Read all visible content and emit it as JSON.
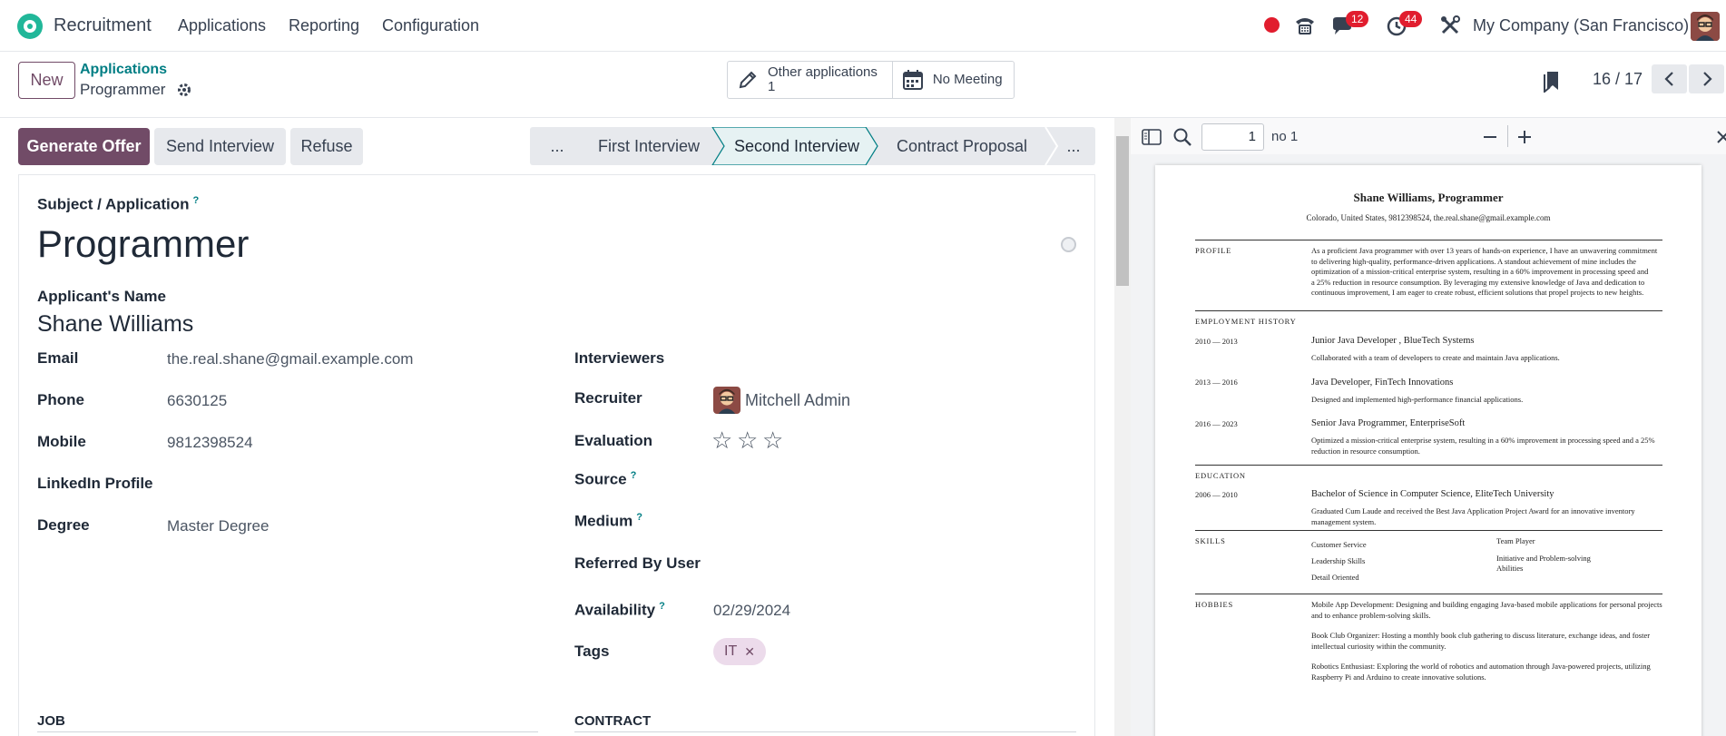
{
  "nav": {
    "app_name": "Recruitment",
    "menu": [
      "Applications",
      "Reporting",
      "Configuration"
    ],
    "messages_count": "12",
    "activities_count": "44",
    "company": "My Company (San Francisco)"
  },
  "control": {
    "new_label": "New",
    "breadcrumb_parent": "Applications",
    "breadcrumb_current": "Programmer",
    "other_applications_label": "Other applications",
    "other_applications_count": "1",
    "meeting_label": "No Meeting",
    "pager": "16 / 17"
  },
  "actions": {
    "generate_offer": "Generate Offer",
    "send_interview": "Send Interview",
    "refuse": "Refuse"
  },
  "stages": {
    "more_left": "...",
    "first": "First Interview",
    "current": "Second Interview",
    "next": "Contract Proposal",
    "more_right": "..."
  },
  "form": {
    "subject_label": "Subject / Application",
    "subject_help": "?",
    "subject": "Programmer",
    "applicant_label": "Applicant's Name",
    "applicant": "Shane Williams",
    "email_label": "Email",
    "email": "the.real.shane@gmail.example.com",
    "phone_label": "Phone",
    "phone": "6630125",
    "mobile_label": "Mobile",
    "mobile": "9812398524",
    "linkedin_label": "LinkedIn Profile",
    "degree_label": "Degree",
    "degree": "Master Degree",
    "interviewers_label": "Interviewers",
    "recruiter_label": "Recruiter",
    "recruiter": "Mitchell Admin",
    "evaluation_label": "Evaluation",
    "evaluation_stars": 0,
    "source_label": "Source",
    "medium_label": "Medium",
    "referred_label": "Referred By User",
    "availability_label": "Availability",
    "availability": "02/29/2024",
    "tags_label": "Tags",
    "tags": [
      "IT"
    ],
    "job_section": "JOB",
    "contract_section": "CONTRACT"
  },
  "pdf": {
    "page_input": "1",
    "page_of": "no 1",
    "name_title": "Shane Williams, Programmer",
    "contact": "Colorado, United States, 9812398524, the.real.shane@gmail.example.com",
    "profile_heading": "PROFILE",
    "profile_lines": [
      "As a proficient Java programmer with over 13 years of hands-on experience, I have an unwavering commitment",
      "to delivering high-quality, performance-driven applications. A standout achievement of mine includes the",
      "optimization of a mission-critical enterprise system, resulting in a 60% improvement in processing speed and",
      "a 25% reduction in resource consumption. By leveraging my extensive knowledge of Java and dedication to",
      "continuous improvement, I am eager to create robust, efficient solutions that propel projects to new heights."
    ],
    "employment_heading": "EMPLOYMENT HISTORY",
    "jobs": [
      {
        "dates": "2010 — 2013",
        "title": "Junior Java Developer , BlueTech Systems",
        "desc": [
          "Collaborated with a team of developers to create and maintain Java applications."
        ]
      },
      {
        "dates": "2013 — 2016",
        "title": "Java Developer, FinTech Innovations",
        "desc": [
          "Designed and implemented high-performance financial applications."
        ]
      },
      {
        "dates": "2016 — 2023",
        "title": "Senior Java Programmer, EnterpriseSoft",
        "desc": [
          "Optimized a mission-critical enterprise system, resulting in a 60% improvement in processing speed and a 25%",
          "reduction in resource consumption."
        ]
      }
    ],
    "education_heading": "EDUCATION",
    "education": {
      "dates": "2006 — 2010",
      "title": "Bachelor of Science in Computer Science, EliteTech University",
      "desc": [
        "Graduated Cum Laude and received the Best Java Application Project Award for an innovative inventory",
        "management system."
      ]
    },
    "skills_heading": "SKILLS",
    "skills_col1": [
      "Customer Service",
      "Leadership Skills",
      "Detail Oriented"
    ],
    "skills_col2": [
      "Team Player",
      "Initiative and Problem-solving",
      "Abilities"
    ],
    "hobbies_heading": "HOBBIES",
    "hobbies": [
      [
        "Mobile App Development: Designing and building engaging Java-based mobile applications for personal projects",
        "and to enhance problem-solving skills."
      ],
      [
        "Book Club Organizer: Hosting a monthly book club gathering to discuss literature, exchange ideas, and foster",
        "intellectual curiosity within the community."
      ],
      [
        "Robotics Enthusiast: Exploring the world of robotics and automation through Java-powered projects, utilizing",
        "Raspberry Pi and Arduino to create innovative solutions."
      ]
    ]
  }
}
